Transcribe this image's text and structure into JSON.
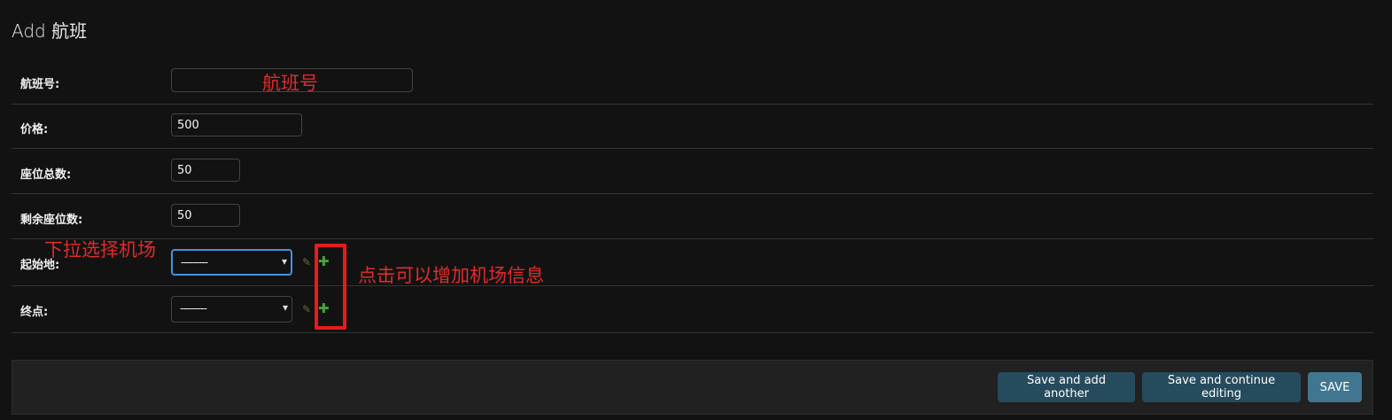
{
  "header": {
    "title": "Add 航班"
  },
  "form": {
    "flight_no_label": "航班号:",
    "flight_no_value": "",
    "price_label": "价格:",
    "price_value": "500",
    "total_seats_label": "座位总数:",
    "total_seats_value": "50",
    "remaining_seats_label": "剩余座位数:",
    "remaining_seats_value": "50",
    "origin_label": "起始地:",
    "origin_selected": "---------",
    "destination_label": "终点:",
    "destination_selected": "---------"
  },
  "icons": {
    "chevron": "▾",
    "pencil": "✎",
    "plus": "✚"
  },
  "annotations": {
    "flight_no_hint": "航班号",
    "dropdown_hint": "下拉选择机场",
    "add_hint": "点击可以增加机场信息"
  },
  "actions": {
    "save_add_another": "Save and add another",
    "save_continue": "Save and continue editing",
    "save": "SAVE"
  },
  "colors": {
    "background": "#121212",
    "button": "#264b5d",
    "button_default": "#417690",
    "annotation": "#e02b2b",
    "add_icon": "#49a33b",
    "focus": "#4a90e2"
  }
}
